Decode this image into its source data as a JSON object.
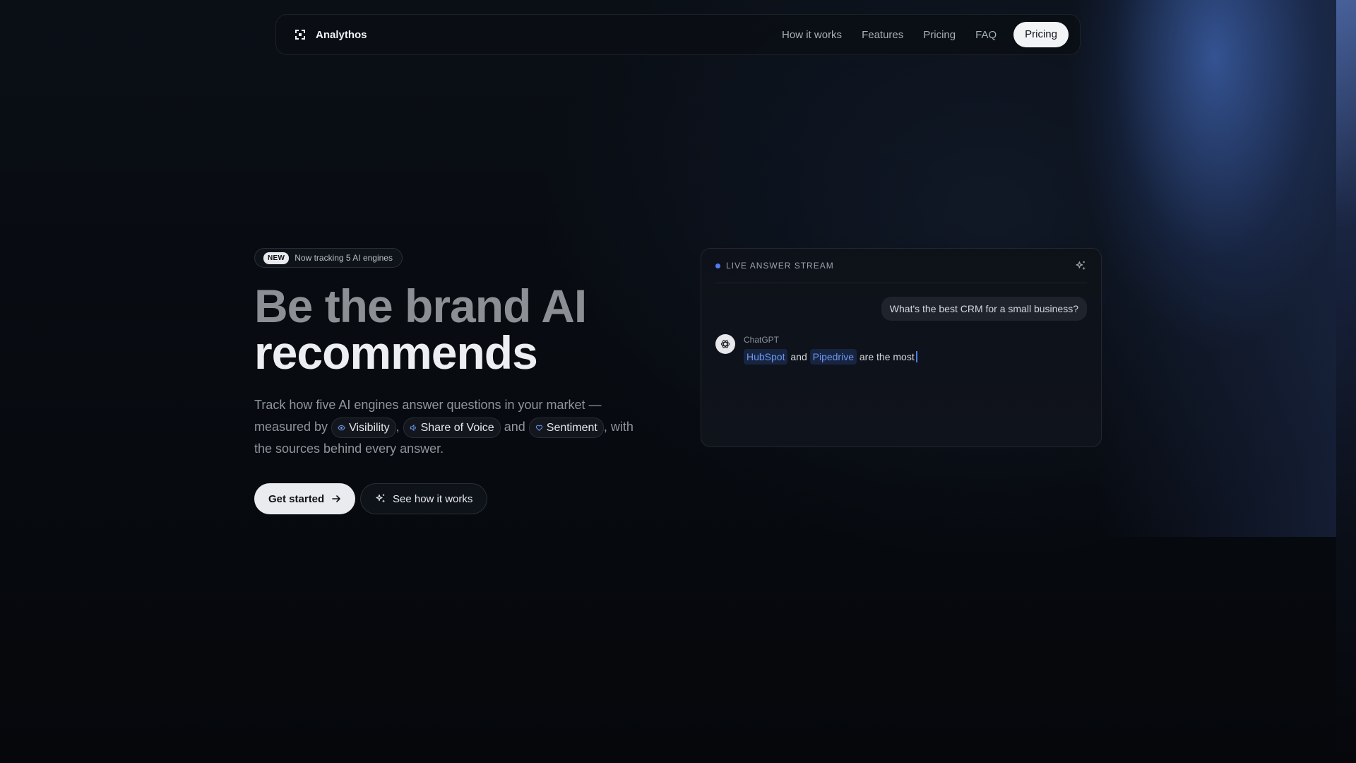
{
  "nav": {
    "brand": "Analythos",
    "links": [
      "How it works",
      "Features",
      "Pricing",
      "FAQ"
    ],
    "cta": "Pricing"
  },
  "hero": {
    "badge_pill": "NEW",
    "badge_text": "Now tracking 5 AI engines",
    "headline_line1": "Be the brand AI",
    "headline_line2": "recommends",
    "sub_part1": "Track how five AI engines answer questions in your market — measured by",
    "chip_visibility": "Visibility",
    "comma": ",",
    "chip_sov": "Share of Voice",
    "and": "and",
    "chip_sentiment": "Sentiment",
    "sub_part2": ", with the sources behind every answer.",
    "primary_button": "Get started",
    "secondary_button": "See how it works"
  },
  "card": {
    "label": "LIVE ANSWER STREAM",
    "question": "What's the best CRM for a small business?",
    "source": "ChatGPT",
    "brand1": "HubSpot",
    "and": "and",
    "brand2": "Pipedrive",
    "tail": "are the most"
  },
  "colors": {
    "accent": "#4f7cf0",
    "background": "#06090e"
  }
}
